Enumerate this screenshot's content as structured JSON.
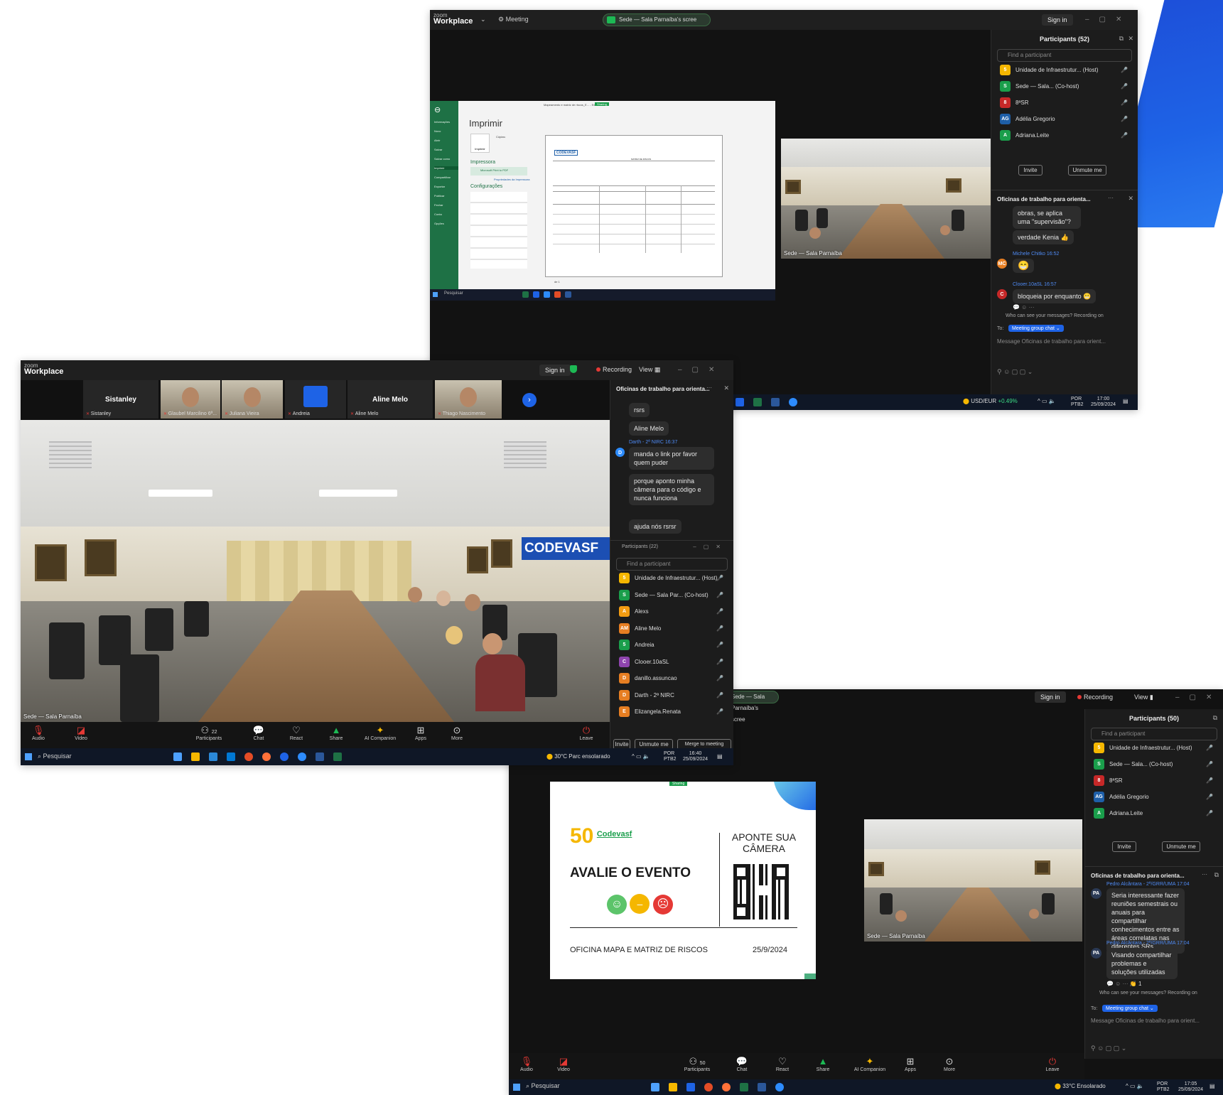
{
  "win1": {
    "logo_small": "zoom",
    "logo": "Workplace",
    "meeting_label": "Meeting",
    "share_pill": "Sede — Sala Parnaíba's scree",
    "sign_in": "Sign in",
    "excel": {
      "title": "Mapeamento e matriz de riscos_E... - Excel",
      "sharing": "Sharing",
      "heading": "Imprimir",
      "copies": "Cópias:",
      "section_printer": "Impressora",
      "printer_name": "Microsoft Print to PDF",
      "printer_props": "Propriedades da Impressora",
      "section_settings": "Configurações",
      "print_btn": "Imprimir",
      "page_logo": "CODEVASF",
      "page_heading": "MATRIZ DE RISCOS",
      "page_nav": "de 1",
      "search": "Pesquisar",
      "sidebar": [
        "Informações",
        "Novo",
        "Abrir",
        "Salvar",
        "Salvar como",
        "Imprimir",
        "Compartilhar",
        "Exportar",
        "Publicar",
        "Fechar",
        "Conta",
        "Opções"
      ]
    },
    "video_label": "Sede — Sala Parnaíba",
    "panel": {
      "title": "Participants (52)",
      "find": "Find a participant",
      "participants": [
        {
          "name": "Unidade de Infraestrutur... (Host)",
          "initials": "5",
          "color": "#f5b700"
        },
        {
          "name": "Sede — Sala... (Co-host)",
          "initials": "S",
          "color": "#1a9e4b"
        },
        {
          "name": "8ªSR",
          "initials": "8",
          "color": "#c62828"
        },
        {
          "name": "Adélia Gregorio",
          "initials": "AG",
          "color": "#1e5fa8"
        },
        {
          "name": "Adriana.Leite",
          "initials": "A",
          "color": "#1a9e4b"
        }
      ],
      "invite": "Invite",
      "unmute": "Unmute me"
    },
    "chat": {
      "title": "Oficinas de trabalho para orienta...",
      "msg1": "obras, se aplica uma \"supervisão\"?",
      "msg2": "verdade Kenia 👍",
      "sender1": "Michele Chitko 16:52",
      "msg3": "😁",
      "sender2": "Clooer.10aSL 16:57",
      "msg4": "bloqueia por enquanto 😬",
      "who": "Who can see your messages? Recording on",
      "to_label": "To:",
      "to_value": "Meeting group chat",
      "placeholder": "Message Oficinas de trabalho para orient..."
    },
    "taskbar": {
      "currency": "USD/EUR",
      "currency_change": "+0.49%",
      "lang1": "POR",
      "lang2": "PTB2",
      "time": "17:00",
      "date": "25/09/2024"
    }
  },
  "win2": {
    "logo_small": "zoom",
    "logo": "Workplace",
    "sign_in": "Sign in",
    "recording": "Recording",
    "view": "View",
    "tiles": [
      {
        "name": "Sistanley",
        "sub": "Sistanley",
        "video": false
      },
      {
        "name": "",
        "sub": "Glaubel Marcilino 6ª...",
        "video": true
      },
      {
        "name": "",
        "sub": "Juliana Vieira",
        "video": true
      },
      {
        "name": "",
        "sub": "Andreia",
        "video": false
      },
      {
        "name": "Aline Melo",
        "sub": "Aline Melo",
        "video": false
      },
      {
        "name": "",
        "sub": "Thiago Nascimento",
        "video": true
      }
    ],
    "video_label": "Sede — Sala Parnaíba",
    "wall_logo": "CODEVASF",
    "chat": {
      "title": "Oficinas de trabalho para orienta...",
      "msg1": "rsrs",
      "msg2": "Aline Melo",
      "sender": "Darth - 2ª NIRC 16:37",
      "msg3": "manda o link por favor quem puder",
      "msg4": "porque aponto minha câmera para o código e nunca funciona",
      "msg5": "ajuda nós rsrsr"
    },
    "panel": {
      "title": "Participants (22)",
      "find": "Find a participant",
      "participants": [
        {
          "name": "Unidade de Infraestrutur... (Host)",
          "initials": "5",
          "color": "#f5b700"
        },
        {
          "name": "Sede — Sala Par... (Co-host)",
          "initials": "S",
          "color": "#1a9e4b"
        },
        {
          "name": "Alexs",
          "initials": "A",
          "color": "#f39c12"
        },
        {
          "name": "Aline Melo",
          "initials": "AM",
          "color": "#e67e22"
        },
        {
          "name": "Andreia",
          "initials": "5",
          "color": "#1a9e4b"
        },
        {
          "name": "Clooer.10aSL",
          "initials": "C",
          "color": "#8e44ad"
        },
        {
          "name": "danillo.assuncao",
          "initials": "D",
          "color": "#e67e22"
        },
        {
          "name": "Darth - 2ª NIRC",
          "initials": "D",
          "color": "#e67e22"
        },
        {
          "name": "Elizangela.Renata",
          "initials": "E",
          "color": "#e67e22"
        }
      ],
      "invite": "Invite",
      "unmute": "Unmute me",
      "merge": "Merge to meeting window"
    },
    "toolbar": {
      "audio": "Audio",
      "video": "Video",
      "participants": "Participants",
      "participants_count": "22",
      "chat": "Chat",
      "react": "React",
      "share": "Share",
      "ai": "AI Companion",
      "apps": "Apps",
      "more": "More",
      "leave": "Leave"
    },
    "taskbar": {
      "search": "Pesquisar",
      "weather": "30°C  Parc ensolarado",
      "lang1": "POR",
      "lang2": "PTB2",
      "time": "16:40",
      "date": "25/09/2024"
    }
  },
  "win3": {
    "share_pill": "Sede — Sala Parnaíba's scree",
    "sign_in": "Sign in",
    "recording": "Recording",
    "view": "View",
    "sharing": "Sharing",
    "slide": {
      "logo_num": "50",
      "logo_text": "Codevasf",
      "camera": "APONTE SUA CÂMERA",
      "evaluate": "AVALIE O EVENTO",
      "footer_left": "OFICINA MAPA E MATRIZ DE RISCOS",
      "footer_right": "25/9/2024"
    },
    "video_label": "Sede — Sala Parnaíba",
    "panel": {
      "title": "Participants (50)",
      "find": "Find a participant",
      "participants": [
        {
          "name": "Unidade de Infraestrutur... (Host)",
          "initials": "5",
          "color": "#f5b700"
        },
        {
          "name": "Sede — Sala... (Co-host)",
          "initials": "S",
          "color": "#1a9e4b"
        },
        {
          "name": "8ªSR",
          "initials": "8",
          "color": "#c62828"
        },
        {
          "name": "Adélia Gregorio",
          "initials": "AG",
          "color": "#1e5fa8"
        },
        {
          "name": "Adriana.Leite",
          "initials": "A",
          "color": "#1a9e4b"
        }
      ],
      "invite": "Invite",
      "unmute": "Unmute me"
    },
    "chat": {
      "title": "Oficinas de trabalho para orienta...",
      "sender0": "Pedro Alcântara - 2ª/GRR/UMA 17:04",
      "msg1": "Seria interessante fazer reuniões semestrais ou anuais para compartilhar conhecimentos entre as áreas correlatas nas diferentes SRs",
      "sender1": "Pedro Alcântara - 2ª/GRR/UMA 17:04",
      "msg2": "Visando compartilhar problemas e soluções utilizadas",
      "initials": "PA",
      "reaction": "👏 1",
      "who": "Who can see your messages? Recording on",
      "to_label": "To:",
      "to_value": "Meeting group chat",
      "placeholder": "Message Oficinas de trabalho para orient..."
    },
    "toolbar": {
      "audio": "Audio",
      "video": "Video",
      "participants": "Participants",
      "participants_count": "50",
      "chat": "Chat",
      "react": "React",
      "share": "Share",
      "ai": "AI Companion",
      "apps": "Apps",
      "more": "More",
      "leave": "Leave"
    },
    "taskbar": {
      "search": "Pesquisar",
      "weather": "33°C  Ensolarado",
      "lang1": "POR",
      "lang2": "PTB2",
      "time": "17:05",
      "date": "25/09/2024"
    }
  }
}
